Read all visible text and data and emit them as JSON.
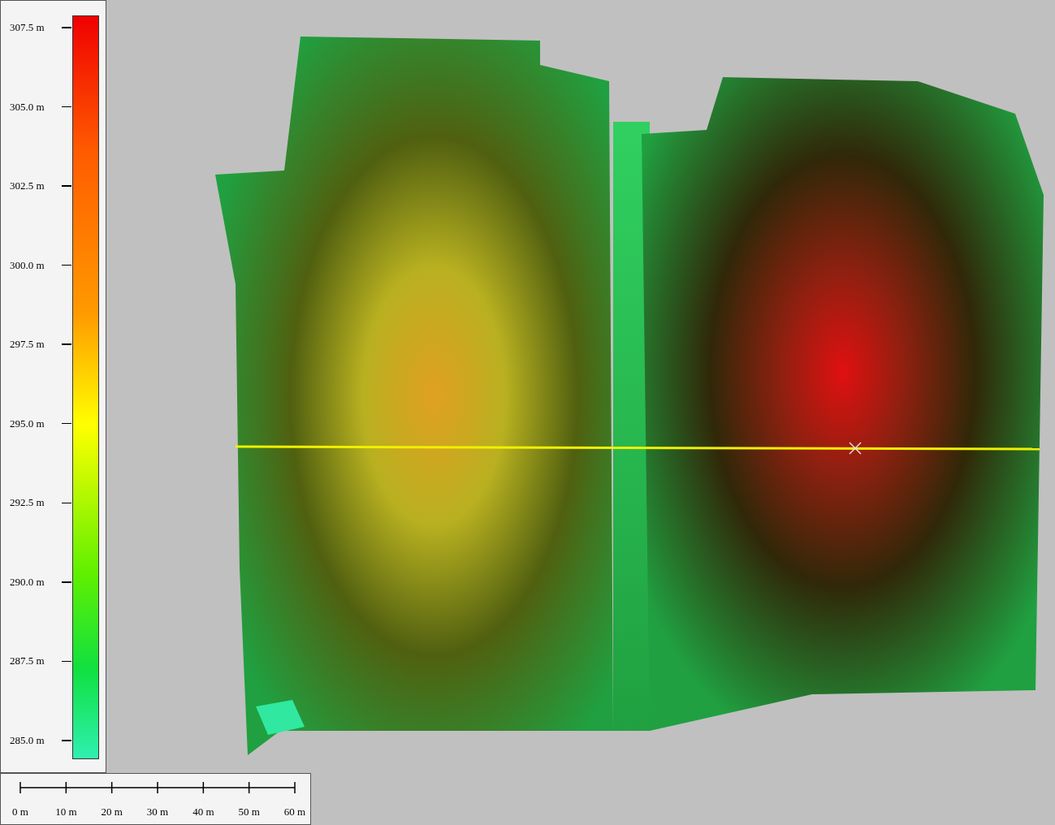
{
  "legend": {
    "labels": [
      "307.5 m",
      "305.0 m",
      "302.5 m",
      "300.0 m",
      "297.5 m",
      "295.0 m",
      "292.5 m",
      "290.0 m",
      "287.5 m",
      "285.0 m"
    ]
  },
  "scale_bar": {
    "labels": [
      "0 m",
      "10 m",
      "20 m",
      "30 m",
      "40 m",
      "50 m",
      "60 m"
    ]
  }
}
